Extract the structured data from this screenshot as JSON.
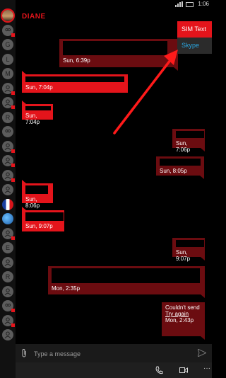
{
  "status": {
    "time": "1:06"
  },
  "rail": {
    "items": [
      {
        "type": "photo",
        "label": "",
        "dot": false
      },
      {
        "type": "icon",
        "label": "",
        "dot": true
      },
      {
        "type": "letter",
        "label": "G",
        "dot": false
      },
      {
        "type": "letter",
        "label": "L",
        "dot": false
      },
      {
        "type": "letter",
        "label": "M",
        "dot": false
      },
      {
        "type": "person",
        "label": "",
        "dot": true
      },
      {
        "type": "person",
        "label": "",
        "dot": true
      },
      {
        "type": "letter",
        "label": "R",
        "dot": false
      },
      {
        "type": "icon",
        "label": "",
        "dot": false
      },
      {
        "type": "person",
        "label": "",
        "dot": true
      },
      {
        "type": "person",
        "label": "",
        "dot": true
      },
      {
        "type": "person",
        "label": "",
        "dot": true
      },
      {
        "type": "person",
        "label": "",
        "dot": false
      },
      {
        "type": "flag",
        "label": "",
        "dot": false
      },
      {
        "type": "globe",
        "label": "",
        "dot": false
      },
      {
        "type": "person",
        "label": "",
        "dot": true
      },
      {
        "type": "letter",
        "label": "E",
        "dot": false
      },
      {
        "type": "person",
        "label": "",
        "dot": false
      },
      {
        "type": "letter",
        "label": "R",
        "dot": false
      },
      {
        "type": "person",
        "label": "",
        "dot": false
      },
      {
        "type": "icon",
        "label": "",
        "dot": true
      },
      {
        "type": "person",
        "label": "",
        "dot": true
      },
      {
        "type": "person",
        "label": "",
        "dot": false
      }
    ]
  },
  "conversation": {
    "contact_name": "DIANE",
    "messages": [
      {
        "direction": "out",
        "time": "Sun, 6:39p",
        "lines": []
      },
      {
        "direction": "in",
        "time": "Sun, 7:04p",
        "lines": []
      },
      {
        "direction": "in",
        "time": "Sun, 7:04p",
        "lines": []
      },
      {
        "direction": "out",
        "time": "Sun, 7:06p",
        "lines": []
      },
      {
        "direction": "out",
        "time": "Sun, 8:05p",
        "lines": []
      },
      {
        "direction": "in",
        "time": "Sun, 8:06p",
        "lines": []
      },
      {
        "direction": "in",
        "time": "Sun, 9:07p",
        "lines": []
      },
      {
        "direction": "out",
        "time": "Sun, 9:07p",
        "lines": []
      },
      {
        "direction": "out",
        "time": "Mon, 2:35p",
        "lines": []
      },
      {
        "direction": "out",
        "time": "Mon, 2:43p",
        "lines": [
          "Couldn't send"
        ],
        "link": "Try again"
      }
    ]
  },
  "send_menu": {
    "items": [
      {
        "label": "SIM Text",
        "selected": true
      },
      {
        "label": "Skype",
        "selected": false
      }
    ]
  },
  "composer": {
    "placeholder": "Type a message"
  },
  "colors": {
    "accent": "#e4141b",
    "outgoing": "#6b0c10",
    "skype": "#2aa6e0"
  }
}
